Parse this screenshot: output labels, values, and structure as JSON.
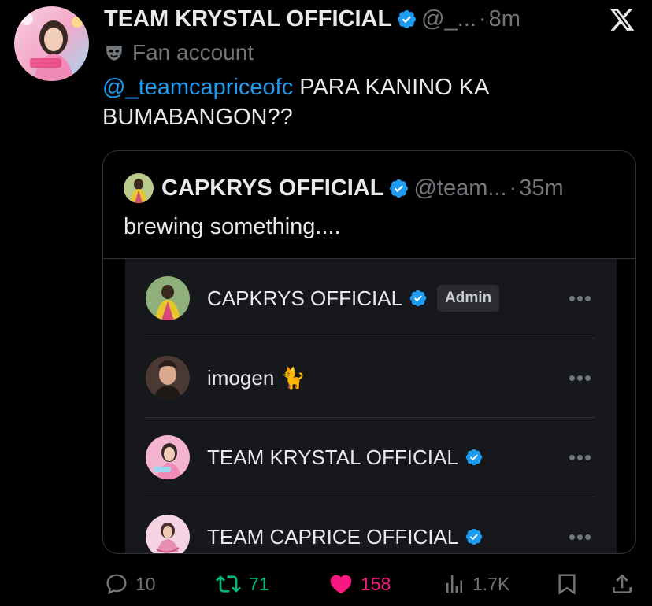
{
  "tweet": {
    "author_name": "TEAM KRYSTAL OFFICIAL",
    "handle": "@_...",
    "separator": "·",
    "time": "8m",
    "account_label": "Fan account",
    "mention": "@_teamcapriceofc",
    "text": " PARA KANINO KA BUMABANGON??"
  },
  "quote": {
    "author_name": "CAPKRYS OFFICIAL",
    "handle": "@team...",
    "separator": "·",
    "time": "35m",
    "text": "brewing something...."
  },
  "members": [
    {
      "name": "CAPKRYS OFFICIAL",
      "verified": true,
      "badge": "Admin",
      "more": "•••"
    },
    {
      "name": "imogen 🐈",
      "verified": false,
      "badge": "",
      "more": "•••"
    },
    {
      "name": "TEAM KRYSTAL OFFICIAL",
      "verified": true,
      "badge": "",
      "more": "•••"
    },
    {
      "name": "TEAM CAPRICE OFFICIAL",
      "verified": true,
      "badge": "",
      "more": "•••"
    }
  ],
  "actions": {
    "replies": "10",
    "reposts": "71",
    "likes": "158",
    "views": "1.7K"
  },
  "colors": {
    "background": "#000000",
    "text": "#e7e9ea",
    "muted": "#71767b",
    "link": "#1d9bf0",
    "repost": "#00ba7c",
    "like": "#f91880",
    "verified": "#1d9bf0"
  },
  "icons": [
    "x-logo-icon",
    "verified-icon",
    "fan-mask-icon",
    "reply-icon",
    "repost-icon",
    "heart-icon",
    "views-icon",
    "bookmark-icon",
    "share-icon",
    "more-icon"
  ]
}
